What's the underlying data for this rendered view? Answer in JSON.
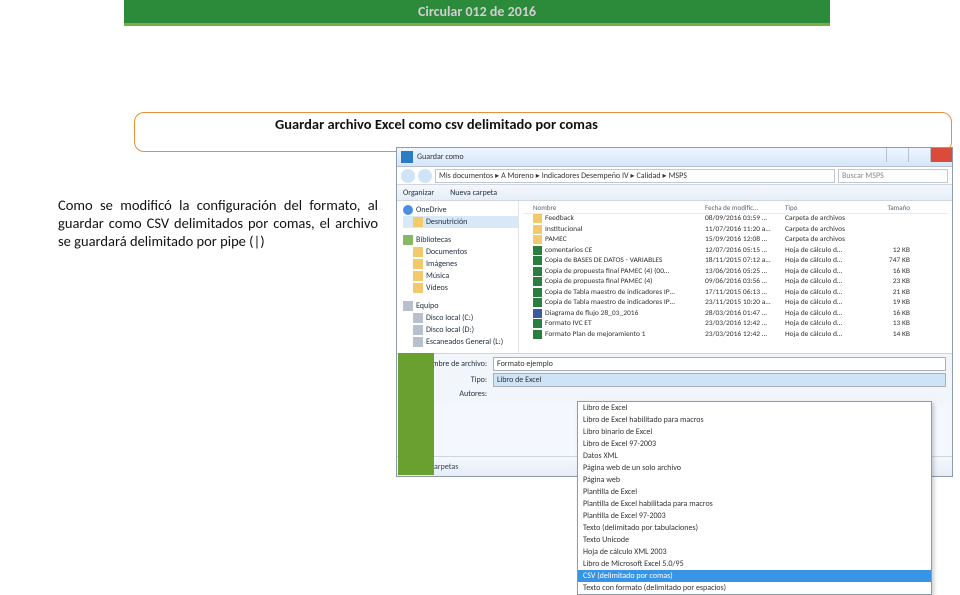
{
  "header": {
    "title": "Circular 012 de 2016"
  },
  "subheading": "Guardar archivo Excel como csv delimitado por comas",
  "explain": "Como se modificó la configuración del formato, al guardar como CSV delimitados por comas, el archivo se guardará delimitado por pipe (|)",
  "dlg": {
    "title": "Guardar como",
    "path": [
      "Mis documentos",
      "A Moreno",
      "Indicadores Desempeño IV",
      "Calidad",
      "MSPS"
    ],
    "search_ph": "Buscar MSPS",
    "toolbar": {
      "org": "Organizar",
      "newf": "Nueva carpeta"
    },
    "cols": {
      "name": "Nombre",
      "date": "Fecha de modific…",
      "type": "Tipo",
      "size": "Tamaño"
    },
    "sidebar": {
      "onedrive": "OneDrive",
      "desnut": "Desnutrición",
      "bibl": "Bibliotecas",
      "docs": "Documentos",
      "img": "Imágenes",
      "mus": "Música",
      "vid": "Vídeos",
      "equipo": "Equipo",
      "c": "Disco local (C:)",
      "d": "Disco local (D:)",
      "e": "Escaneados General (L:)"
    },
    "files": [
      {
        "ic": "folder",
        "n": "Feedback",
        "d": "08/09/2016 03:59 …",
        "t": "Carpeta de archivos",
        "s": ""
      },
      {
        "ic": "folder",
        "n": "Institucional",
        "d": "11/07/2016 11:20 a…",
        "t": "Carpeta de archivos",
        "s": ""
      },
      {
        "ic": "folder",
        "n": "PAMEC",
        "d": "15/09/2016 12:08 …",
        "t": "Carpeta de archivos",
        "s": ""
      },
      {
        "ic": "xls",
        "n": "comentarios CE",
        "d": "12/07/2016 05:15 …",
        "t": "Hoja de cálculo d…",
        "s": "12 KB"
      },
      {
        "ic": "xls",
        "n": "Copia de BASES DE DATOS - VARIABLES",
        "d": "18/11/2015 07:12 a…",
        "t": "Hoja de cálculo d…",
        "s": "747 KB"
      },
      {
        "ic": "xls",
        "n": "Copia de propuesta final PAMEC (4) (00…",
        "d": "13/06/2016 05:25 …",
        "t": "Hoja de cálculo d…",
        "s": "16 KB"
      },
      {
        "ic": "xls",
        "n": "Copia de propuesta final PAMEC (4)",
        "d": "09/06/2016 03:56 …",
        "t": "Hoja de cálculo d…",
        "s": "23 KB"
      },
      {
        "ic": "xls",
        "n": "Copia de Tabla maestro de indicadores IP…",
        "d": "17/11/2015 06:13 …",
        "t": "Hoja de cálculo d…",
        "s": "21 KB"
      },
      {
        "ic": "xls",
        "n": "Copia de Tabla maestro de indicadores IP…",
        "d": "23/11/2015 10:20 a…",
        "t": "Hoja de cálculo d…",
        "s": "19 KB"
      },
      {
        "ic": "vsd",
        "n": "Diagrama de flujo 28_03_2016",
        "d": "28/03/2016 01:47 …",
        "t": "Hoja de cálculo d…",
        "s": "16 KB"
      },
      {
        "ic": "xls",
        "n": "Formato IVC ET",
        "d": "23/03/2016 12:42 …",
        "t": "Hoja de cálculo d…",
        "s": "13 KB"
      },
      {
        "ic": "xls",
        "n": "Formato Plan de mejoramiento 1",
        "d": "23/03/2016 12:42 …",
        "t": "Hoja de cálculo d…",
        "s": "14 KB"
      }
    ],
    "filename_lbl": "Nombre de archivo:",
    "filename_val": "Formato ejemplo",
    "type_lbl": "Tipo:",
    "type_val": "Libro de Excel",
    "authors_lbl": "Autores:",
    "hide": "Ocultar carpetas",
    "types": [
      "Libro de Excel",
      "Libro de Excel habilitado para macros",
      "Libro binario de Excel",
      "Libro de Excel 97-2003",
      "Datos XML",
      "Página web de un solo archivo",
      "Página web",
      "Plantilla de Excel",
      "Plantilla de Excel habilitada para macros",
      "Plantilla de Excel 97-2003",
      "Texto (delimitado por tabulaciones)",
      "Texto Unicode",
      "Hoja de cálculo XML 2003",
      "Libro de Microsoft Excel 5.0/95",
      "CSV (delimitado por comas)",
      "Texto con formato (delimitado por espacios)"
    ],
    "type_hi_index": 14
  }
}
